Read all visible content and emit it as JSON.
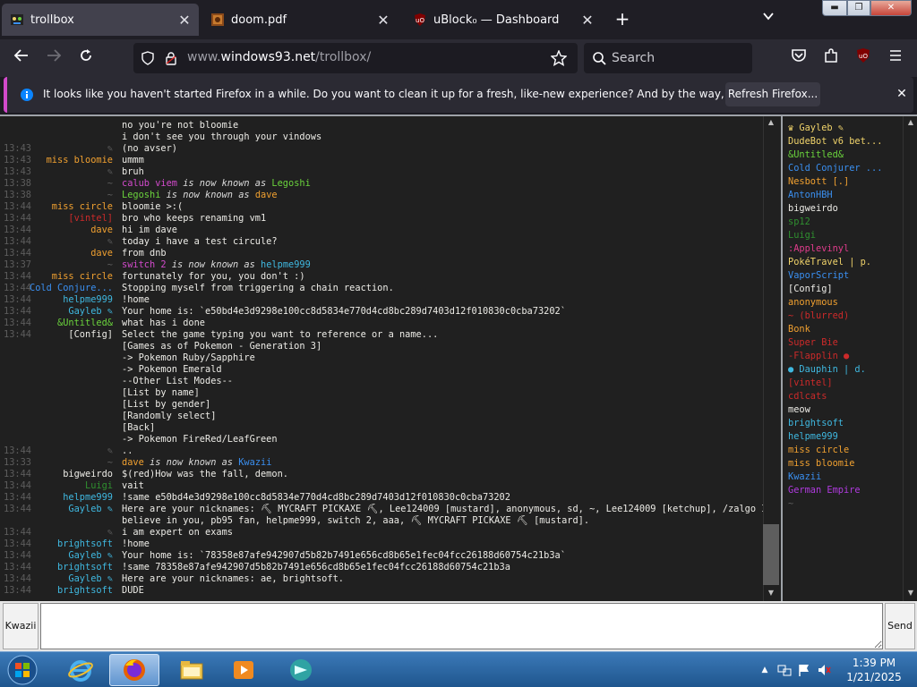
{
  "browser": {
    "tabs": [
      {
        "title": "trollbox",
        "active": true,
        "icon": "trollbox-favicon-icon"
      },
      {
        "title": "doom.pdf",
        "active": false,
        "icon": "pdf-favicon-icon"
      },
      {
        "title": "uBlock₀ — Dashboard",
        "active": false,
        "icon": "ublock-favicon-icon"
      }
    ],
    "url": {
      "prefix": "www.",
      "domain": "windows93.net",
      "path": "/trollbox/"
    },
    "search_placeholder": "Search",
    "notification": {
      "text": "It looks like you haven't started Firefox in a while. Do you want to clean it up for a fresh, like-new experience? And by the way, welcome back!",
      "button_label": "Refresh Firefox..."
    }
  },
  "chat": {
    "messages": [
      {
        "time": "",
        "nick": "",
        "nick_color": "#5d5d5d",
        "text": "no you're not bloomie",
        "kind": "msg"
      },
      {
        "time": "",
        "nick": "",
        "nick_color": "#5d5d5d",
        "text": "i don't see you through your vindows",
        "kind": "msg"
      },
      {
        "time": "13:43",
        "nick": "✎",
        "nick_color": "#5d5d5d",
        "text": "(no avser)",
        "kind": "msg"
      },
      {
        "time": "13:43",
        "nick": "miss bloomie",
        "nick_color": "#f0a030",
        "text": "ummm",
        "kind": "msg"
      },
      {
        "time": "13:43",
        "nick": "✎",
        "nick_color": "#5d5d5d",
        "text": "bruh",
        "kind": "msg"
      },
      {
        "time": "13:38",
        "nick": "~",
        "nick_color": "#5d5d5d",
        "text_a": "calub viem",
        "color_a": "#d24acb",
        "text_mid": "is now known as",
        "text_b": "Legoshi",
        "color_b": "#6ad23c",
        "kind": "rename"
      },
      {
        "time": "13:38",
        "nick": "~",
        "nick_color": "#5d5d5d",
        "text_a": "Legoshi",
        "color_a": "#6ad23c",
        "text_mid": "is now known as",
        "text_b": "dave",
        "color_b": "#f0a030",
        "kind": "rename"
      },
      {
        "time": "13:44",
        "nick": "miss circle",
        "nick_color": "#f0a030",
        "text": "bloomie >:(",
        "kind": "msg"
      },
      {
        "time": "13:44",
        "nick": "[vintel]",
        "nick_color": "#cc2a2a",
        "text": "bro who keeps renaming vm1",
        "kind": "msg"
      },
      {
        "time": "13:44",
        "nick": "dave",
        "nick_color": "#f0a030",
        "text": "hi im dave",
        "kind": "msg"
      },
      {
        "time": "13:44",
        "nick": "✎",
        "nick_color": "#5d5d5d",
        "text": "today i have a test circule?",
        "kind": "msg"
      },
      {
        "time": "13:44",
        "nick": "dave",
        "nick_color": "#f0a030",
        "text": "from dnb",
        "kind": "msg"
      },
      {
        "time": "13:37",
        "nick": "~",
        "nick_color": "#5d5d5d",
        "text_a": "switch 2",
        "color_a": "#d24acb",
        "text_mid": "is now known as",
        "text_b": "helpme999",
        "color_b": "#3fb8e0",
        "kind": "rename"
      },
      {
        "time": "13:44",
        "nick": "miss circle",
        "nick_color": "#f0a030",
        "text": "fortunately for you, you don't :)",
        "kind": "msg"
      },
      {
        "time": "13:44",
        "nick": "Cold Conjure...",
        "nick_color": "#3a8ff0",
        "text": "Stopping myself from triggering a chain reaction.",
        "kind": "msg"
      },
      {
        "time": "13:44",
        "nick": "helpme999",
        "nick_color": "#3fb8e0",
        "text": "!home",
        "kind": "msg"
      },
      {
        "time": "13:44",
        "nick": "Gayleb ✎",
        "nick_color": "#3fb8e0",
        "text": "Your home is: `e50bd4e3d9298e100cc8d5834e770d4cd8bc289d7403d12f010830c0cba73202`",
        "kind": "msg"
      },
      {
        "time": "13:44",
        "nick": "&Untitled&",
        "nick_color": "#6ad23c",
        "text": "what has i done",
        "kind": "msg"
      },
      {
        "time": "13:44",
        "nick": "[Config]",
        "nick_color": "#ecebe6",
        "text": "Select the game typing you want to reference or a name...",
        "kind": "msg"
      },
      {
        "time": "",
        "nick": "",
        "nick_color": "#5d5d5d",
        "text": "[Games as of Pokemon - Generation 3]",
        "kind": "msg"
      },
      {
        "time": "",
        "nick": "",
        "nick_color": "#5d5d5d",
        "text": "-> Pokemon Ruby/Sapphire",
        "kind": "msg"
      },
      {
        "time": "",
        "nick": "",
        "nick_color": "#5d5d5d",
        "text": "-> Pokemon Emerald",
        "kind": "msg"
      },
      {
        "time": "",
        "nick": "",
        "nick_color": "#5d5d5d",
        "text": "--Other List Modes--",
        "kind": "msg"
      },
      {
        "time": "",
        "nick": "",
        "nick_color": "#5d5d5d",
        "text": "[List by name]",
        "kind": "msg"
      },
      {
        "time": "",
        "nick": "",
        "nick_color": "#5d5d5d",
        "text": "[List by gender]",
        "kind": "msg"
      },
      {
        "time": "",
        "nick": "",
        "nick_color": "#5d5d5d",
        "text": "[Randomly select]",
        "kind": "msg"
      },
      {
        "time": "",
        "nick": "",
        "nick_color": "#5d5d5d",
        "text": "[Back]",
        "kind": "msg"
      },
      {
        "time": "",
        "nick": "",
        "nick_color": "#5d5d5d",
        "text": "-> Pokemon FireRed/LeafGreen",
        "kind": "msg"
      },
      {
        "time": "13:44",
        "nick": "✎",
        "nick_color": "#5d5d5d",
        "text": "..",
        "kind": "msg"
      },
      {
        "time": "13:33",
        "nick": "~",
        "nick_color": "#5d5d5d",
        "text_a": "dave",
        "color_a": "#f0a030",
        "text_mid": "is now known as",
        "text_b": "Kwazii",
        "color_b": "#3a8ff0",
        "kind": "rename"
      },
      {
        "time": "13:44",
        "nick": "bigweirdo",
        "nick_color": "#ecebe6",
        "text": "$(red)How was the fall, demon.",
        "kind": "msg"
      },
      {
        "time": "13:44",
        "nick": "Luigi",
        "nick_color": "#2f8f2f",
        "text": "vait",
        "kind": "msg"
      },
      {
        "time": "13:44",
        "nick": "helpme999",
        "nick_color": "#3fb8e0",
        "text": "!same e50bd4e3d9298e100cc8d5834e770d4cd8bc289d7403d12f010830c0cba73202",
        "kind": "msg"
      },
      {
        "time": "13:44",
        "nick": "Gayleb ✎",
        "nick_color": "#3fb8e0",
        "text": "Here are your nicknames: ⛏ MYCRAFT PICKAXE ⛏, Lee124009 [mustard], anonymous, sd, ~, Lee124009 [ketchup], /zalgo I",
        "kind": "msg"
      },
      {
        "time": "",
        "nick": "",
        "nick_color": "#5d5d5d",
        "text": "believe in you, pb95 fan, helpme999, switch 2, aaa, ⛏ MYCRAFT PICKAXE ⛏ [mustard].",
        "kind": "msg"
      },
      {
        "time": "13:44",
        "nick": "✎",
        "nick_color": "#5d5d5d",
        "text": "i am expert on exams",
        "kind": "msg"
      },
      {
        "time": "13:44",
        "nick": "brightsoft",
        "nick_color": "#3fb8e0",
        "text": "!home",
        "kind": "msg"
      },
      {
        "time": "13:44",
        "nick": "Gayleb ✎",
        "nick_color": "#3fb8e0",
        "text": "Your home is: `78358e87afe942907d5b82b7491e656cd8b65e1fec04fcc26188d60754c21b3a`",
        "kind": "msg"
      },
      {
        "time": "13:44",
        "nick": "brightsoft",
        "nick_color": "#3fb8e0",
        "text": "!same 78358e87afe942907d5b82b7491e656cd8b65e1fec04fcc26188d60754c21b3a",
        "kind": "msg"
      },
      {
        "time": "13:44",
        "nick": "Gayleb ✎",
        "nick_color": "#3fb8e0",
        "text": "Here are your nicknames: ae, brightsoft.",
        "kind": "msg"
      },
      {
        "time": "13:44",
        "nick": "brightsoft",
        "nick_color": "#3fb8e0",
        "text": "DUDE",
        "kind": "msg"
      }
    ],
    "users": [
      {
        "name": "♛ Gayleb ✎",
        "color": "#f0d36a"
      },
      {
        "name": "DudeBot v6 bet...",
        "color": "#f0d36a"
      },
      {
        "name": "&Untitled&",
        "color": "#6ad23c"
      },
      {
        "name": "Cold Conjurer ...",
        "color": "#3a8ff0"
      },
      {
        "name": "Nesbott [.]",
        "color": "#f0a030"
      },
      {
        "name": "AntonHBH",
        "color": "#3a8ff0"
      },
      {
        "name": "bigweirdo",
        "color": "#ecebe6"
      },
      {
        "name": "sp12",
        "color": "#2f8f2f"
      },
      {
        "name": "Luigi",
        "color": "#2f8f2f"
      },
      {
        "name": ":Applevinyl",
        "color": "#e03c8c"
      },
      {
        "name": "PokéTravel | p.",
        "color": "#f0d36a"
      },
      {
        "name": "VaporScript",
        "color": "#3a8ff0"
      },
      {
        "name": "[Config]",
        "color": "#ecebe6"
      },
      {
        "name": "anonymous",
        "color": "#f0a030"
      },
      {
        "name": "~ (blurred)",
        "color": "#cc2a2a"
      },
      {
        "name": "Bonk",
        "color": "#f0a030"
      },
      {
        "name": "Super Bie",
        "color": "#cc2a2a"
      },
      {
        "name": "-Flapplin ●",
        "color": "#cc2a2a"
      },
      {
        "name": "● Dauphin | d.",
        "color": "#3fb8e0"
      },
      {
        "name": "[vintel]",
        "color": "#cc2a2a"
      },
      {
        "name": "cdlcats",
        "color": "#cc2a2a"
      },
      {
        "name": "meow",
        "color": "#ecebe6"
      },
      {
        "name": "brightsoft",
        "color": "#3fb8e0"
      },
      {
        "name": "helpme999",
        "color": "#3fb8e0"
      },
      {
        "name": "miss circle",
        "color": "#f0a030"
      },
      {
        "name": "miss bloomie",
        "color": "#f0a030"
      },
      {
        "name": "Kwazii",
        "color": "#3a8ff0"
      },
      {
        "name": "German Empire",
        "color": "#b03adf"
      },
      {
        "name": "~",
        "color": "#5d5d5d"
      }
    ],
    "my_nick": "Kwazii",
    "input_value": "",
    "send_label": "Send"
  },
  "taskbar": {
    "items": [
      {
        "icon": "internet-explorer-icon"
      },
      {
        "icon": "firefox-icon",
        "active": true
      },
      {
        "icon": "file-explorer-icon"
      },
      {
        "icon": "media-player-icon"
      },
      {
        "icon": "chat-app-icon"
      }
    ],
    "clock_time": "1:39 PM",
    "clock_date": "1/21/2025"
  },
  "colors": {
    "accent": "#d24acb",
    "chat_bg": "#202020",
    "timestamp": "#5d5d5d"
  }
}
